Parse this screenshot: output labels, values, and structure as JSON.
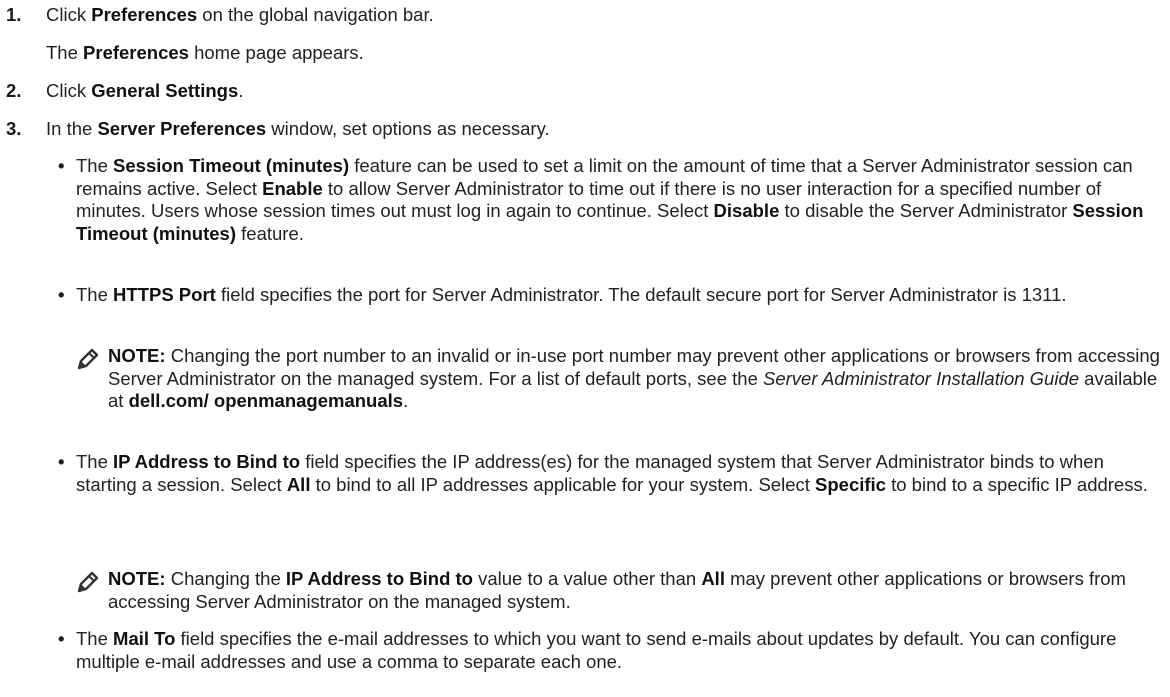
{
  "steps": [
    {
      "number": "1.",
      "pre": "Click ",
      "bold": "Preferences",
      "post": " on the global navigation bar.",
      "result_pre": "The ",
      "result_bold": "Preferences",
      "result_post": " home page appears."
    },
    {
      "number": "2.",
      "pre": "Click ",
      "bold": "General Settings",
      "post": "."
    },
    {
      "number": "3.",
      "pre": "In the ",
      "bold": "Server Preferences",
      "post": " window, set options as necessary."
    }
  ],
  "bullets": {
    "session": {
      "t1": "The ",
      "b1": "Session Timeout (minutes)",
      "t2": " feature can be used to set a limit on the amount of time that a Server Administrator session can remains active. Select ",
      "b2": "Enable",
      "t3": " to allow Server Administrator to time out if there is no user interaction for a specified number of minutes. Users whose session times out must log in again to continue. Select ",
      "b3": "Disable",
      "t4": " to disable the Server Administrator ",
      "b4": "Session Timeout (minutes)",
      "t5": " feature."
    },
    "https": {
      "t1": "The ",
      "b1": "HTTPS Port",
      "t2": " field specifies the port for Server Administrator. The default secure port for Server Administrator is 1311."
    },
    "note1": {
      "label": "NOTE:",
      "t1": " Changing the port number to an invalid or in-use port number may prevent other applications or browsers from accessing Server Administrator on the managed system. For a list of default ports, see the ",
      "i1": "Server Administrator Installation Guide",
      "t2": " available at ",
      "b1": "dell.com/ openmanagemanuals",
      "t3": "."
    },
    "ip": {
      "t1": "The ",
      "b1": "IP Address to Bind to",
      "t2": " field specifies the IP address(es) for the managed system that Server Administrator binds to when starting a session. Select ",
      "b2": "All",
      "t3": " to bind to all IP addresses applicable for your system. Select ",
      "b3": "Specific",
      "t4": " to bind to a specific IP address."
    },
    "note2": {
      "label": "NOTE:",
      "t1": " Changing the ",
      "b1": "IP Address to Bind to",
      "t2": " value to a value other than ",
      "b2": "All",
      "t3": " may prevent other applications or browsers from accessing Server Administrator on the managed system."
    },
    "mail": {
      "t1": "The ",
      "b1": "Mail To",
      "t2": " field specifies the e-mail addresses to which you want to send e-mails about updates by default. You can configure multiple e-mail addresses and use a comma to separate each one."
    }
  },
  "bullet_glyph": "•",
  "icons": {
    "note": "pencil-note-icon"
  },
  "colors": {
    "text": "#222222",
    "icon": "#333333"
  }
}
